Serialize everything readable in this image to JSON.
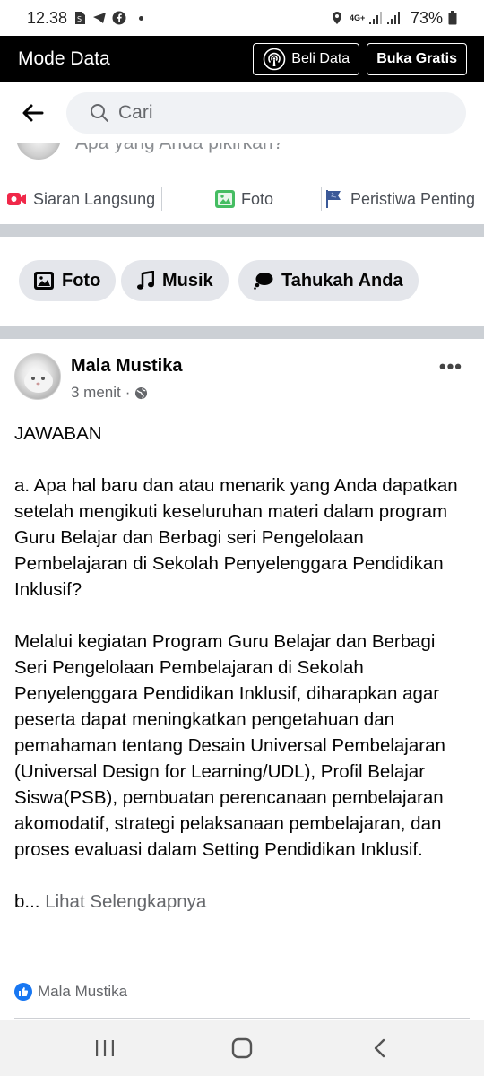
{
  "status_bar": {
    "time": "12.38",
    "network": "4G+",
    "battery": "73%",
    "icons_left": [
      "sim-icon",
      "telegram-icon",
      "facebook-icon",
      "dot-icon"
    ],
    "icons_right": [
      "location-icon",
      "signal-icon",
      "battery-icon"
    ]
  },
  "data_mode": {
    "title": "Mode Data",
    "buy_data_label": "Beli Data",
    "open_free_label": "Buka Gratis"
  },
  "search": {
    "placeholder": "Cari"
  },
  "composer": {
    "prompt": "Apa yang Anda pikirkan?",
    "actions": [
      {
        "label": "Siaran Langsung",
        "icon": "live-video-icon",
        "color": "#f02849"
      },
      {
        "label": "Foto",
        "icon": "photo-icon",
        "color": "#45bd62"
      },
      {
        "label": "Peristiwa Penting",
        "icon": "flag-icon",
        "color": "#3b5998"
      }
    ]
  },
  "chips": [
    {
      "label": "Foto",
      "icon": "photo-icon"
    },
    {
      "label": "Musik",
      "icon": "music-icon"
    },
    {
      "label": "Tahukah Anda",
      "icon": "speech-bubble-icon"
    }
  ],
  "post": {
    "author": "Mala Mustika",
    "time": "3 menit",
    "privacy_icon": "globe-icon",
    "paragraphs": [
      "JAWABAN",
      "a. Apa hal baru dan atau menarik yang Anda dapatkan setelah mengikuti keseluruhan materi dalam program Guru Belajar dan Berbagi seri Pengelolaan Pembelajaran di Sekolah Penyelenggara Pendidikan Inklusif?",
      "Melalui kegiatan Program Guru Belajar dan Berbagi Seri Pengelolaan Pembelajaran di Sekolah Penyelenggara Pendidikan Inklusif, diharapkan agar peserta dapat meningkatkan pengetahuan dan pemahaman tentang Desain Universal Pembelajaran (Universal Design for Learning/UDL), Profil Belajar Siswa(PSB), pembuatan perencanaan pembelajaran akomodatif, strategi pelaksanaan pembelajaran, dan proses evaluasi dalam Setting Pendidikan Inklusif."
    ],
    "truncated_text": "b...",
    "see_more_label": "Lihat Selengkapnya",
    "reaction_name": "Mala Mustika"
  },
  "colors": {
    "facebook_blue": "#1877f2",
    "chip_bg": "#e4e6eb",
    "separator": "#ccd0d5"
  }
}
